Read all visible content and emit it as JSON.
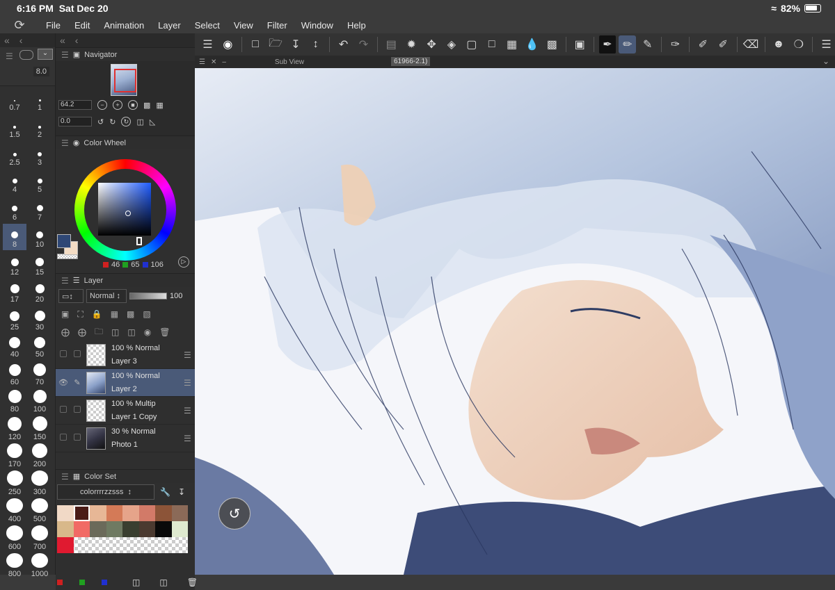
{
  "status": {
    "time": "6:16 PM",
    "date": "Sat Dec 20",
    "battery": "82%"
  },
  "menu": [
    "File",
    "Edit",
    "Animation",
    "Layer",
    "Select",
    "View",
    "Filter",
    "Window",
    "Help"
  ],
  "brush": {
    "size_value": "8.0",
    "sizes": [
      "0.7",
      "1",
      "1.5",
      "2",
      "2.5",
      "3",
      "4",
      "5",
      "6",
      "7",
      "8",
      "10",
      "12",
      "15",
      "17",
      "20",
      "25",
      "30",
      "40",
      "50",
      "60",
      "70",
      "80",
      "100",
      "120",
      "150",
      "170",
      "200",
      "250",
      "300",
      "400",
      "500",
      "600",
      "700",
      "800",
      "1000"
    ],
    "selected": "8"
  },
  "navigator": {
    "title": "Navigator",
    "zoom": "64.2",
    "angle": "0.0"
  },
  "color_wheel": {
    "title": "Color Wheel",
    "main_color": "#2e4775",
    "sub_color": "#f3dcc4",
    "r": "46",
    "g": "65",
    "b": "106"
  },
  "layer_panel": {
    "title": "Layer",
    "blend_mode": "Normal",
    "opacity": "100",
    "layers": [
      {
        "info": "100 %  Normal",
        "name": "Layer 3",
        "selected": false
      },
      {
        "info": "100 %  Normal",
        "name": "Layer 2",
        "selected": true
      },
      {
        "info": "100 %  Multip",
        "name": "Layer 1 Copy",
        "selected": false
      },
      {
        "info": "30 %  Normal",
        "name": "Photo 1",
        "selected": false
      }
    ]
  },
  "color_set": {
    "title": "Color Set",
    "set_name": "colorrrrzzsss",
    "swatches": [
      "#f1d9c6",
      "#4a1c17",
      "#e7b796",
      "#d47a57",
      "#e6a48a",
      "#d27a68",
      "#8c5438",
      "#8b6a58",
      "#d8b88a",
      "#f16a65",
      "#6b6a5a",
      "#6f7a62",
      "#3a3f30",
      "#4b3a30",
      "#0a0a0a",
      "#dfead0",
      "#e01a30"
    ]
  },
  "document": {
    "subview": "Sub View",
    "tab_title": "61966-2.1)"
  },
  "colors": {
    "accent": "#4a5a78",
    "panel": "#2f2f2f"
  }
}
